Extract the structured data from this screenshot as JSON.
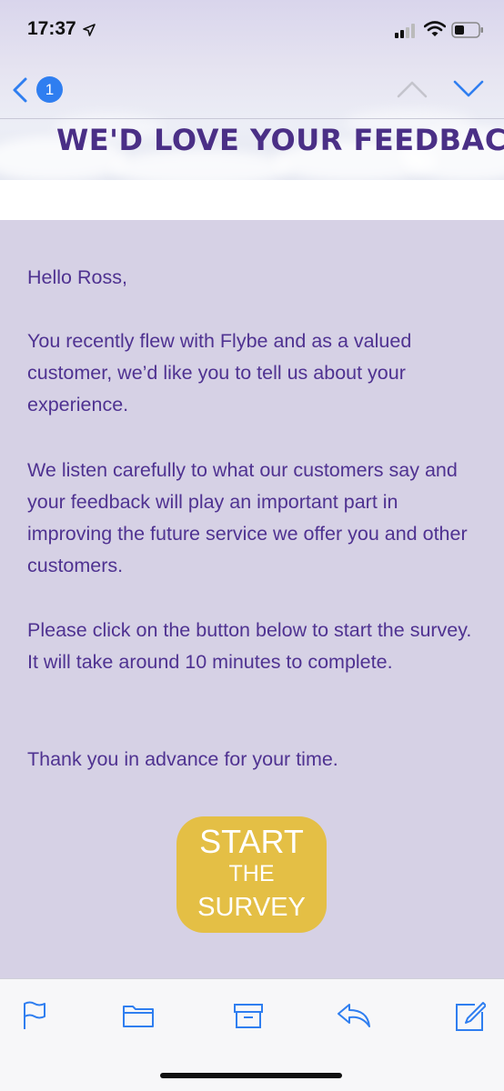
{
  "status_bar": {
    "time": "17:37",
    "icons": [
      "location-arrow-icon",
      "cellular-signal-icon",
      "wifi-icon",
      "battery-icon"
    ]
  },
  "nav": {
    "unread_badge": "1",
    "icons": [
      "back-chevron-icon",
      "previous-message-icon",
      "next-message-icon"
    ]
  },
  "email": {
    "banner_title": "WE'D LOVE YOUR FEEDBACK",
    "paragraphs": [
      "Hello Ross,",
      "You recently flew with Flybe and as a valued customer, we’d like you to tell us about your experience.",
      "We listen carefully to what our customers say and your feedback will play an important part in improving the future service we offer you and other customers.",
      "Please click on the button below to start the survey. It will take around 10 minutes to complete.",
      "Thank you in advance for your time."
    ],
    "cta": {
      "line1": "START",
      "line2": "THE",
      "line3": "SURVEY"
    }
  },
  "toolbar": {
    "icons": [
      "flag-icon",
      "folder-icon",
      "archive-icon",
      "reply-icon",
      "compose-icon"
    ]
  },
  "colors": {
    "accent": "#2f7ef0",
    "text_purple": "#4f3291",
    "banner_purple": "#4a2f86",
    "panel_bg": "#d6d1e5",
    "cta_yellow": "#e4bf45"
  }
}
